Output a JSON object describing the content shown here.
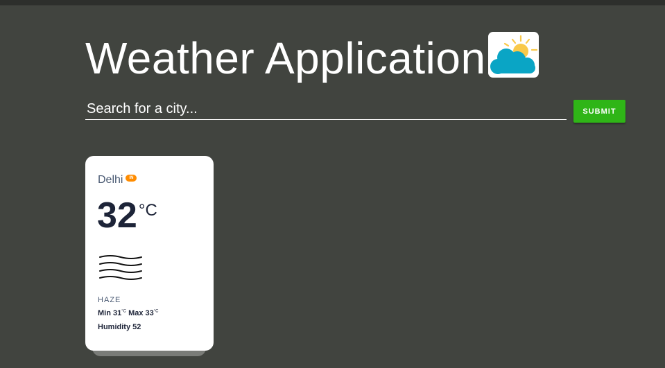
{
  "app": {
    "title": "Weather Application",
    "logo_icon": "sun-behind-cloud-icon"
  },
  "search": {
    "placeholder": "Search for a city...",
    "value": "",
    "submit_label": "SUBMIT"
  },
  "colors": {
    "background": "#41443f",
    "submit": "#2fb517",
    "country_badge": "#ff8c00",
    "cloud": "#0aa5c5",
    "sun": "#f9c94a"
  },
  "weather_cards": [
    {
      "city": "Delhi",
      "country": "IN",
      "temperature": "32",
      "temperature_unit": "°C",
      "icon": "haze-icon",
      "description": "HAZE",
      "min_label": "Min",
      "min": "31",
      "max_label": "Max",
      "max": "33",
      "temp_unit_small": "°C",
      "humidity_label": "Humidity",
      "humidity": "52"
    }
  ]
}
